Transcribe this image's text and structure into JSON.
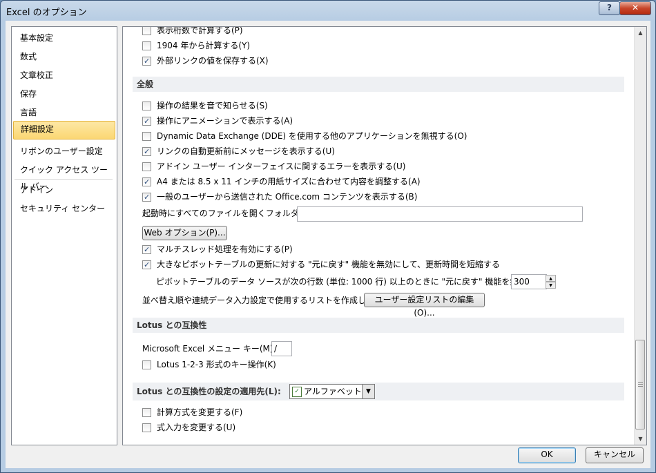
{
  "window": {
    "title": "Excel のオプション",
    "help_label": "?",
    "close_label": "✕"
  },
  "sidebar": {
    "items": [
      {
        "label": "基本設定"
      },
      {
        "label": "数式"
      },
      {
        "label": "文章校正"
      },
      {
        "label": "保存"
      },
      {
        "label": "言語"
      },
      {
        "label": "詳細設定",
        "selected": true
      },
      {
        "label": "リボンのユーザー設定"
      },
      {
        "label": "クイック アクセス ツール バー"
      },
      {
        "label": "アドイン"
      },
      {
        "label": "セキュリティ センター"
      }
    ]
  },
  "options_top": [
    {
      "label": "表示桁数で計算する(P)",
      "checked": false
    },
    {
      "label": "1904 年から計算する(Y)",
      "checked": false
    },
    {
      "label": "外部リンクの値を保存する(X)",
      "checked": true
    }
  ],
  "general": {
    "header": "全般",
    "options": [
      {
        "label": "操作の結果を音で知らせる(S)",
        "checked": false
      },
      {
        "label": "操作にアニメーションで表示する(A)",
        "checked": true
      },
      {
        "label": "Dynamic Data Exchange (DDE) を使用する他のアプリケーションを無視する(O)",
        "checked": false
      },
      {
        "label": "リンクの自動更新前にメッセージを表示する(U)",
        "checked": true
      },
      {
        "label": "アドイン ユーザー インターフェイスに関するエラーを表示する(U)",
        "checked": false
      },
      {
        "label": "A4 または 8.5 x 11 インチの用紙サイズに合わせて内容を調整する(A)",
        "checked": true
      },
      {
        "label": "一般のユーザーから送信された Office.com コンテンツを表示する(B)",
        "checked": true
      }
    ],
    "startup_label": "起動時にすべてのファイルを開くフォルダー(L):",
    "startup_value": "",
    "web_options_button": "Web オプション(P)...",
    "multithread_label": "マルチスレッド処理を有効にする(P)",
    "multithread_checked": true,
    "pivot_undo_label": "大きなピボットテーブルの更新に対する \"元に戻す\" 機能を無効にして、更新時間を短縮する",
    "pivot_undo_checked": true,
    "pivot_rows_label": "ピボットテーブルのデータ ソースが次の行数 (単位: 1000 行) 以上のときに \"元に戻す\" 機能を無効にする:",
    "pivot_rows_value": "300",
    "sort_list_label": "並べ替え順や連続データ入力設定で使用するリストを作成します:",
    "sort_list_button": "ユーザー設定リストの編集(O)..."
  },
  "lotus": {
    "header": "Lotus との互換性",
    "menu_key_label": "Microsoft Excel メニュー キー(M):",
    "menu_key_value": "/",
    "keys_label": "Lotus 1-2-3 形式のキー操作(K)",
    "keys_checked": false
  },
  "lotus_settings": {
    "header": "Lotus との互換性の設定の適用先(L):",
    "selected_sheet": "アルファベット",
    "options": [
      {
        "label": "計算方式を変更する(F)",
        "checked": false
      },
      {
        "label": "式入力を変更する(U)",
        "checked": false
      }
    ]
  },
  "footer": {
    "ok_label": "OK",
    "cancel_label": "キャンセル"
  }
}
